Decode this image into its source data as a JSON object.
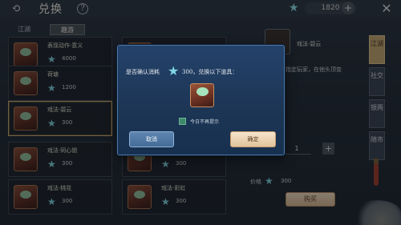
{
  "header": {
    "title": "兑换",
    "back_icon": "arrow-back-icon",
    "help_icon": "question-icon",
    "currency_value": "1820",
    "currency_add": "+",
    "close_icon": "close-icon"
  },
  "tabs": [
    {
      "label": "江湖"
    },
    {
      "label": "趣游"
    }
  ],
  "items": [
    {
      "name": "表现动作·意义",
      "price": "4000"
    },
    {
      "name": "",
      "price": ""
    },
    {
      "name": "荷塘",
      "price": "1200"
    },
    {
      "name": "",
      "price": ""
    },
    {
      "name": "戏法·碧云",
      "price": "300"
    },
    {
      "name": "",
      "price": ""
    },
    {
      "name": "戏法·同心锁",
      "price": "300"
    },
    {
      "name": "",
      "price": "300"
    },
    {
      "name": "戏法·桃花",
      "price": "300"
    },
    {
      "name": "戏法·彩虹",
      "price": "300"
    }
  ],
  "detail": {
    "name": "戏法·碧云",
    "description": "指定玩家，在他头顶变",
    "quantity": "1",
    "plus": "+",
    "total_label": "价格",
    "total": "300",
    "buy_label": "购买"
  },
  "side_tabs": [
    {
      "label": "江湖"
    },
    {
      "label": "社交"
    },
    {
      "label": "银两"
    },
    {
      "label": "随市"
    }
  ],
  "modal": {
    "question_prefix": "是否确认消耗",
    "question_suffix": "300，兑换以下道具：",
    "dont_remind": "今日不再提示",
    "cancel_label": "取消",
    "confirm_label": "确定"
  },
  "colors": {
    "accent": "#c6a66f",
    "modal_bg": "#1d3656",
    "currency_star": "#7fd6e2"
  }
}
